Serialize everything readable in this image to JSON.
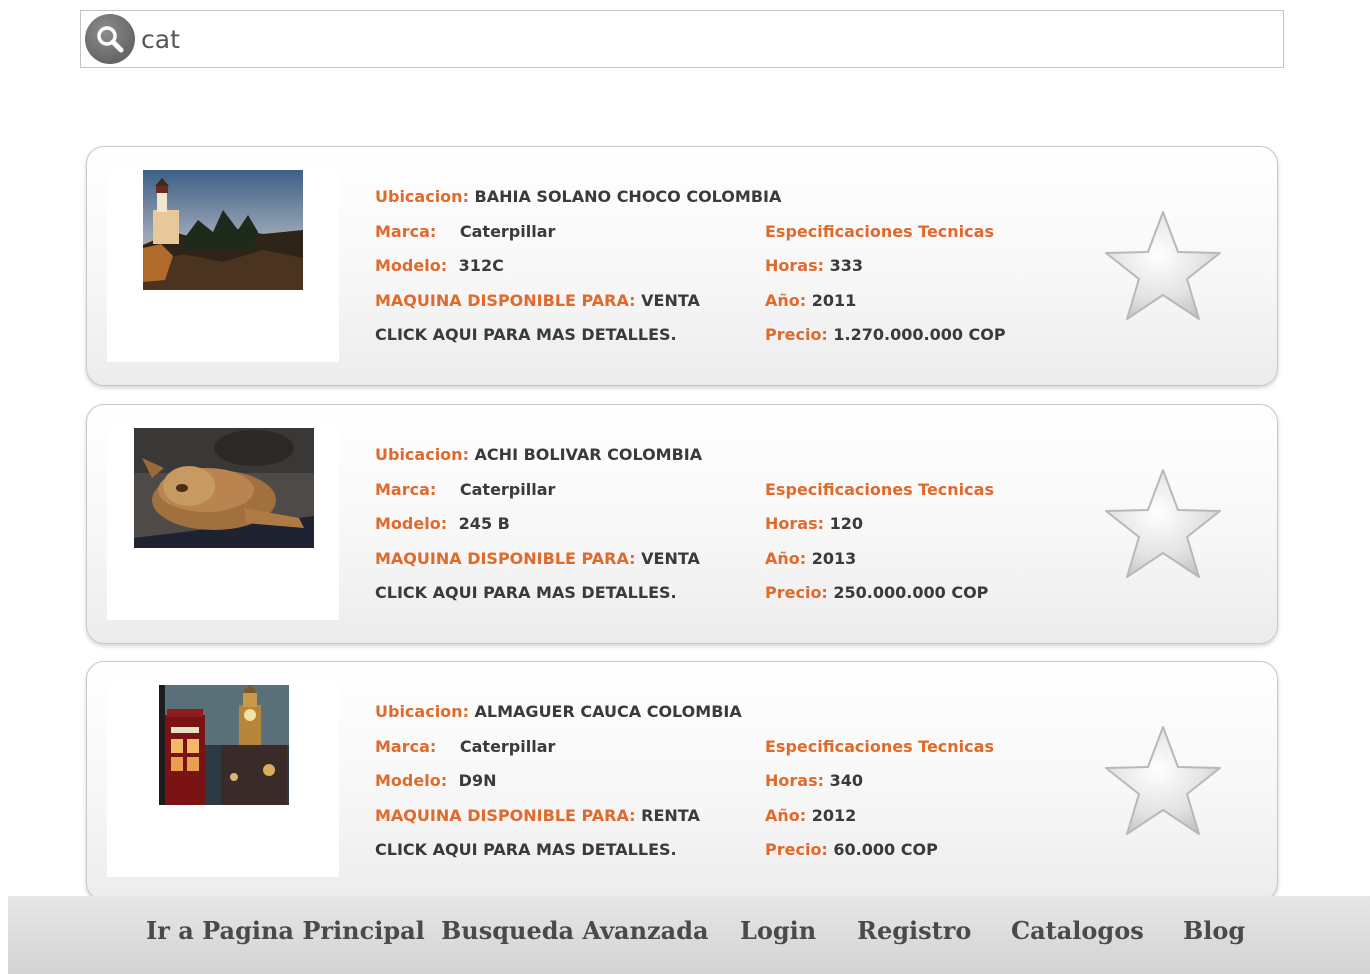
{
  "search": {
    "value": "cat"
  },
  "labels": {
    "ubicacion": "Ubicacion:",
    "marca": "Marca:",
    "modelo": "Modelo:",
    "disponible": "MAQUINA DISPONIBLE PARA:",
    "detalles": "CLICK AQUI PARA MAS DETALLES.",
    "especificaciones": "Especificaciones Tecnicas",
    "horas": "Horas:",
    "anio": "Año:",
    "precio": "Precio:"
  },
  "listings": [
    {
      "ubicacion": "BAHIA SOLANO CHOCO COLOMBIA",
      "marca": "Caterpillar",
      "modelo": "312C",
      "disponible": "VENTA",
      "horas": "333",
      "anio": "2011",
      "precio": "1.270.000.000 COP",
      "image": "lighthouse-photo"
    },
    {
      "ubicacion": "ACHI BOLIVAR COLOMBIA",
      "marca": "Caterpillar",
      "modelo": "245 B",
      "disponible": "VENTA",
      "horas": "120",
      "anio": "2013",
      "precio": "250.000.000 COP",
      "image": "lion-cub-photo"
    },
    {
      "ubicacion": "ALMAGUER CAUCA COLOMBIA",
      "marca": "Caterpillar",
      "modelo": "D9N",
      "disponible": "RENTA",
      "horas": "340",
      "anio": "2012",
      "precio": "60.000 COP",
      "image": "london-big-ben-photo"
    }
  ],
  "nav": {
    "home": "Ir a Pagina Principal",
    "advanced": "Busqueda Avanzada",
    "login": "Login",
    "register": "Registro",
    "catalogs": "Catalogos",
    "blog": "Blog"
  },
  "colors": {
    "label": "#e06a2c",
    "value": "#3a3a3a",
    "footer": "#dcdcdc"
  }
}
